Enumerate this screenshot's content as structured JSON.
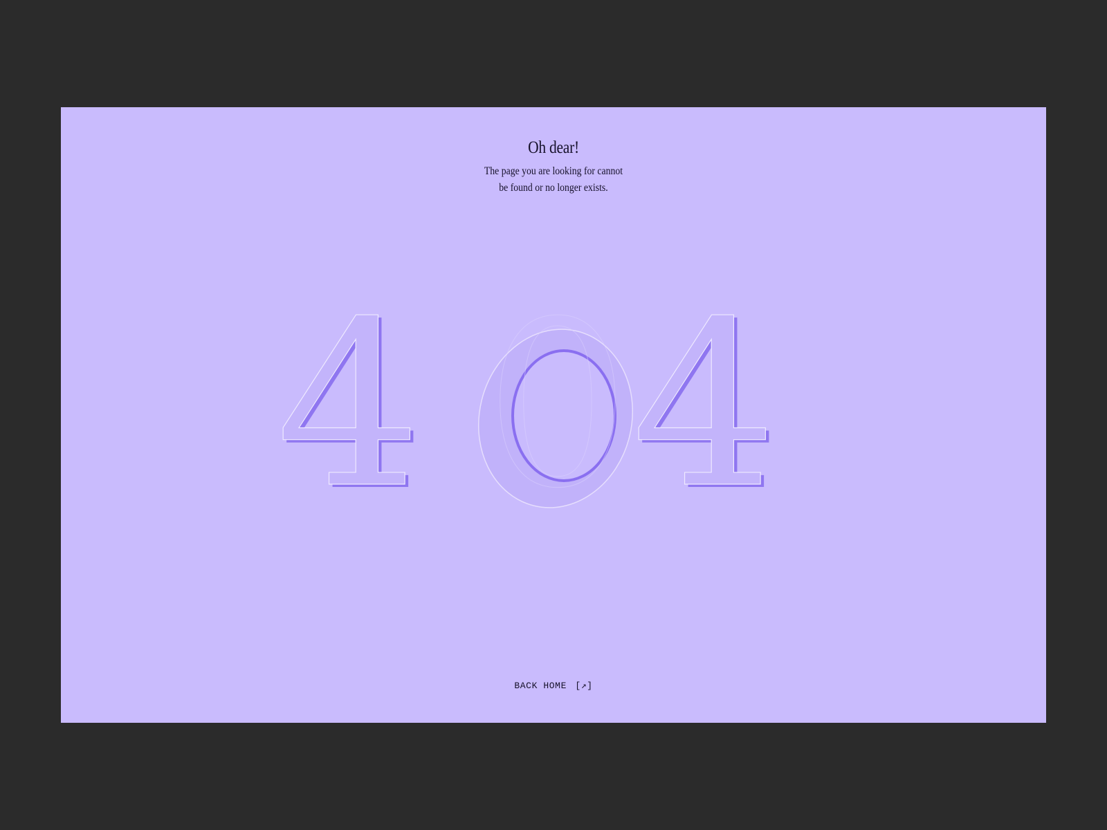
{
  "page": {
    "background_color": "#2b2b2b",
    "panel_color": "#c9bbfd"
  },
  "message": {
    "title": "Oh dear!",
    "description_line1": "The page you are looking for cannot",
    "description_line2": "be found or no longer exists."
  },
  "error_code": {
    "digit1": "4",
    "digit2": "0",
    "digit3": "4",
    "fill_color": "#c3b4fb",
    "edge_color": "#8d73f0",
    "highlight_color": "#f1ecff"
  },
  "navigation": {
    "back_label": "BACK HOME",
    "back_icon": "[↗]"
  }
}
